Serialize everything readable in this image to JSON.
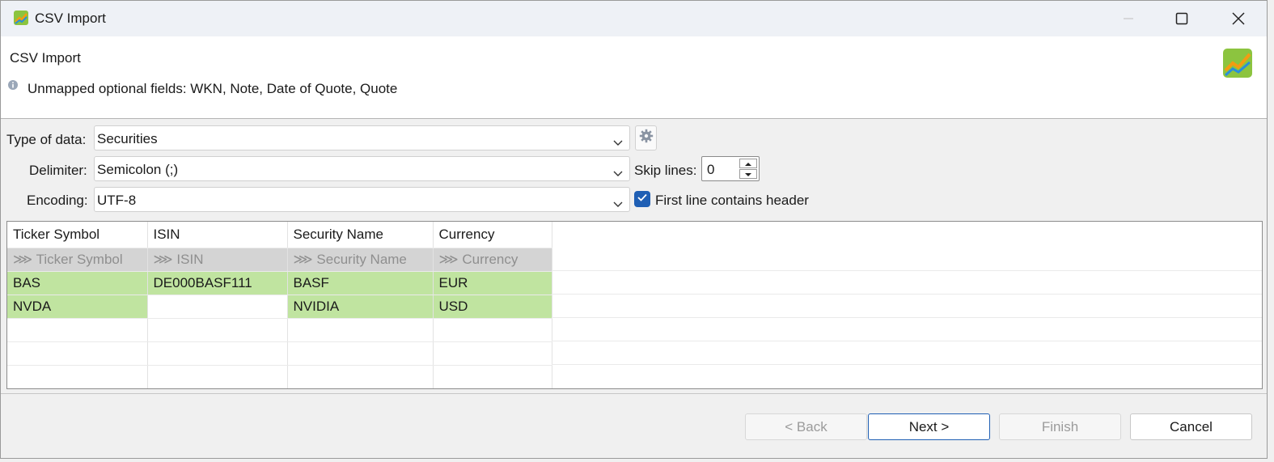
{
  "window": {
    "title": "CSV Import",
    "controls": {
      "minimize": "minimize-icon",
      "maximize": "maximize-icon",
      "close": "close-icon"
    }
  },
  "header": {
    "title": "CSV Import",
    "message": "Unmapped optional fields: WKN, Note, Date of Quote, Quote"
  },
  "form": {
    "type_label": "Type of data:",
    "type_value": "Securities",
    "delimiter_label": "Delimiter:",
    "delimiter_value": "Semicolon (;)",
    "encoding_label": "Encoding:",
    "encoding_value": "UTF-8",
    "skip_label": "Skip lines:",
    "skip_value": "0",
    "header_checkbox_label": "First line contains header",
    "header_checkbox_checked": true
  },
  "table": {
    "columns": [
      "Ticker Symbol",
      "ISIN",
      "Security Name",
      "Currency"
    ],
    "mappings": [
      "⋙ Ticker Symbol",
      "⋙ ISIN",
      "⋙ Security Name",
      "⋙ Currency"
    ],
    "rows": [
      [
        "BAS",
        "DE000BASF111",
        "BASF",
        "EUR"
      ],
      [
        "NVDA",
        "",
        "NVIDIA",
        "USD"
      ]
    ]
  },
  "buttons": {
    "back": "< Back",
    "next": "Next >",
    "finish": "Finish",
    "cancel": "Cancel"
  },
  "colors": {
    "mapped_cell": "#c0e4a0",
    "mapping_row": "#d4d4d4",
    "accent": "#1f5fb4"
  }
}
